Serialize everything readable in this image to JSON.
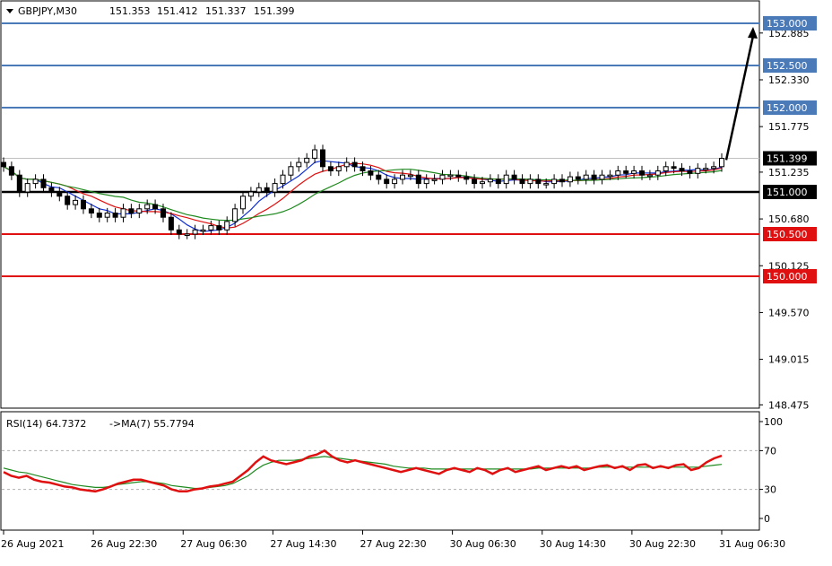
{
  "header": {
    "symbol": "GBPJPY,M30",
    "open": "151.353",
    "high": "151.412",
    "low": "151.337",
    "close": "151.399"
  },
  "rsi_header": {
    "label": "RSI(14) 64.7372",
    "ma_label": "->MA(7) 55.7794"
  },
  "colors": {
    "blue_level": "#4a7ab8",
    "red_level": "#e01010",
    "black_level": "#000000",
    "ma_red": "#e01010",
    "ma_green": "#1f8a1f",
    "ma_blue": "#1030d0",
    "rsi_line": "#e01010",
    "rsi_ma": "#1f8a1f",
    "price_tag": "#000000"
  },
  "chart_data": {
    "type": "candlestick",
    "price_axis": {
      "range": [
        148.4,
        153.05
      ],
      "ticks": [
        "152.885",
        "152.330",
        "151.775",
        "151.235",
        "150.680",
        "150.125",
        "149.570",
        "149.015",
        "148.475"
      ]
    },
    "x_axis": {
      "labels": [
        "26 Aug 2021",
        "26 Aug 22:30",
        "27 Aug 06:30",
        "27 Aug 14:30",
        "27 Aug 22:30",
        "30 Aug 06:30",
        "30 Aug 14:30",
        "30 Aug 22:30",
        "31 Aug 06:30"
      ]
    },
    "levels": [
      {
        "value": 153.0,
        "label": "153.000",
        "color": "blue"
      },
      {
        "value": 152.5,
        "label": "152.500",
        "color": "blue"
      },
      {
        "value": 152.0,
        "label": "152.000",
        "color": "blue"
      },
      {
        "value": 151.0,
        "label": "151.000",
        "color": "black"
      },
      {
        "value": 150.5,
        "label": "150.500",
        "color": "red"
      },
      {
        "value": 150.0,
        "label": "150.000",
        "color": "red"
      }
    ],
    "current_price": {
      "value": 151.399,
      "label": "151.399"
    },
    "arrow": {
      "from": 151.4,
      "to": 153.0
    },
    "closes": [
      151.3,
      151.2,
      151.0,
      151.1,
      151.15,
      151.05,
      151.0,
      150.95,
      150.85,
      150.9,
      150.8,
      150.75,
      150.7,
      150.75,
      150.7,
      150.8,
      150.75,
      150.8,
      150.85,
      150.8,
      150.7,
      150.55,
      150.5,
      150.5,
      150.55,
      150.55,
      150.6,
      150.55,
      150.65,
      150.8,
      150.95,
      151.0,
      151.05,
      151.0,
      151.1,
      151.2,
      151.3,
      151.35,
      151.4,
      151.5,
      151.3,
      151.25,
      151.3,
      151.35,
      151.3,
      151.25,
      151.2,
      151.15,
      151.1,
      151.15,
      151.2,
      151.2,
      151.1,
      151.15,
      151.15,
      151.2,
      151.2,
      151.18,
      151.15,
      151.1,
      151.12,
      151.15,
      151.1,
      151.2,
      151.15,
      151.1,
      151.15,
      151.1,
      151.1,
      151.15,
      151.12,
      151.18,
      151.15,
      151.2,
      151.15,
      151.2,
      151.2,
      151.25,
      151.22,
      151.25,
      151.2,
      151.2,
      151.25,
      151.3,
      151.28,
      151.25,
      151.22,
      151.28,
      151.28,
      151.3,
      151.399
    ],
    "rsi": {
      "range": [
        0,
        100
      ],
      "ticks": [
        "100",
        "70",
        "30",
        "0"
      ],
      "levels": [
        70,
        30
      ],
      "values": [
        48,
        44,
        42,
        44,
        40,
        38,
        37,
        35,
        33,
        32,
        30,
        29,
        28,
        30,
        33,
        36,
        38,
        40,
        40,
        38,
        36,
        34,
        30,
        28,
        28,
        30,
        31,
        33,
        34,
        36,
        38,
        44,
        50,
        58,
        64,
        60,
        58,
        56,
        58,
        60,
        64,
        66,
        70,
        64,
        60,
        58,
        60,
        58,
        56,
        54,
        52,
        50,
        48,
        50,
        52,
        50,
        48,
        46,
        50,
        52,
        50,
        48,
        52,
        50,
        46,
        50,
        52,
        48,
        50,
        52,
        54,
        50,
        52,
        54,
        52,
        54,
        50,
        52,
        54,
        55,
        52,
        54,
        50,
        55,
        56,
        52,
        54,
        52,
        55,
        56,
        50,
        52,
        58,
        62,
        64.7
      ],
      "ma_values": [
        52,
        50,
        48,
        47,
        45,
        43,
        41,
        39,
        37,
        35,
        34,
        33,
        32,
        32,
        33,
        35,
        36,
        37,
        38,
        38,
        37,
        36,
        34,
        33,
        32,
        31,
        31,
        32,
        33,
        34,
        36,
        40,
        44,
        50,
        55,
        58,
        60,
        60,
        60,
        61,
        62,
        63,
        64,
        63,
        62,
        61,
        60,
        59,
        58,
        57,
        56,
        54,
        53,
        52,
        52,
        52,
        51,
        51,
        51,
        51,
        51,
        51,
        51,
        51,
        51,
        51,
        51,
        51,
        51,
        51,
        52,
        52,
        52,
        52,
        52,
        52,
        52,
        52,
        53,
        53,
        53,
        53,
        53,
        53,
        53,
        53,
        53,
        53,
        53,
        53,
        53,
        53,
        54,
        55,
        55.8
      ]
    }
  }
}
